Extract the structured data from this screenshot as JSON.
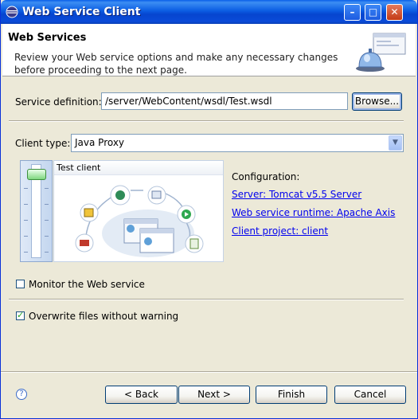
{
  "window": {
    "title": "Web Service Client",
    "min_glyph": "–",
    "max_glyph": "□",
    "close_glyph": "✕"
  },
  "banner": {
    "title": "Web Services",
    "description": "Review your Web service options and make any necessary changes before proceeding to the next page."
  },
  "service_definition": {
    "label": "Service definition:",
    "value": "/server/WebContent/wsdl/Test.wsdl",
    "browse_label": "Browse..."
  },
  "client_type": {
    "label": "Client type:",
    "value": "Java Proxy"
  },
  "illustration": {
    "header": "Test client"
  },
  "configuration": {
    "heading": "Configuration:",
    "server": "Server: Tomcat v5.5 Server",
    "runtime": "Web service runtime: Apache Axis",
    "project": "Client project: client"
  },
  "options": {
    "monitor_label": "Monitor the Web service",
    "monitor_checked": false,
    "overwrite_label": "Overwrite files without warning",
    "overwrite_checked": true
  },
  "footer": {
    "help_glyph": "?",
    "back_label": "< Back",
    "next_label": "Next >",
    "finish_label": "Finish",
    "cancel_label": "Cancel"
  },
  "colors": {
    "titlebar": "#0a5fe8",
    "link": "#0000ee",
    "dialog_bg": "#ece9d8"
  }
}
